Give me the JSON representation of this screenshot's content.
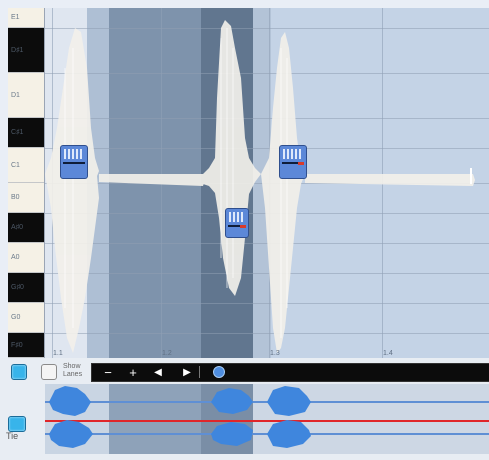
{
  "piano": {
    "keys": [
      {
        "label": "E1",
        "black": false
      },
      {
        "label": "D♯1",
        "black": true
      },
      {
        "label": "D1",
        "black": false
      },
      {
        "label": "C♯1",
        "black": true
      },
      {
        "label": "C1",
        "black": false
      },
      {
        "label": "B0",
        "black": false
      },
      {
        "label": "A♯0",
        "black": true
      },
      {
        "label": "A0",
        "black": false
      },
      {
        "label": "G♯0",
        "black": true
      },
      {
        "label": "G0",
        "black": false
      },
      {
        "label": "F♯0",
        "black": true
      }
    ]
  },
  "ruler": {
    "markers": [
      "1.1",
      "1.2",
      "1.3",
      "1.4"
    ]
  },
  "notes": [
    {
      "pitch": "C1",
      "bar": "1.1"
    },
    {
      "pitch": "A♯0",
      "bar": "1.2"
    },
    {
      "pitch": "C1",
      "bar": "1.3"
    }
  ],
  "transport": {
    "show_lanes_label_line1": "Show",
    "show_lanes_label_line2": "Lanes",
    "minus_symbol": "−",
    "plus_symbol": "+",
    "prev_symbol": "◀",
    "next_symbol": "▶"
  },
  "lanes": {
    "tie_label": "Tie"
  },
  "colors": {
    "grid_bg": "#c6d5e7",
    "region_dark": "#7e93ac",
    "region_light": "#dfe7f2",
    "note_blue": "#5c88d8",
    "accent_blue": "#38b4ea",
    "lane_red": "#e0262a"
  }
}
